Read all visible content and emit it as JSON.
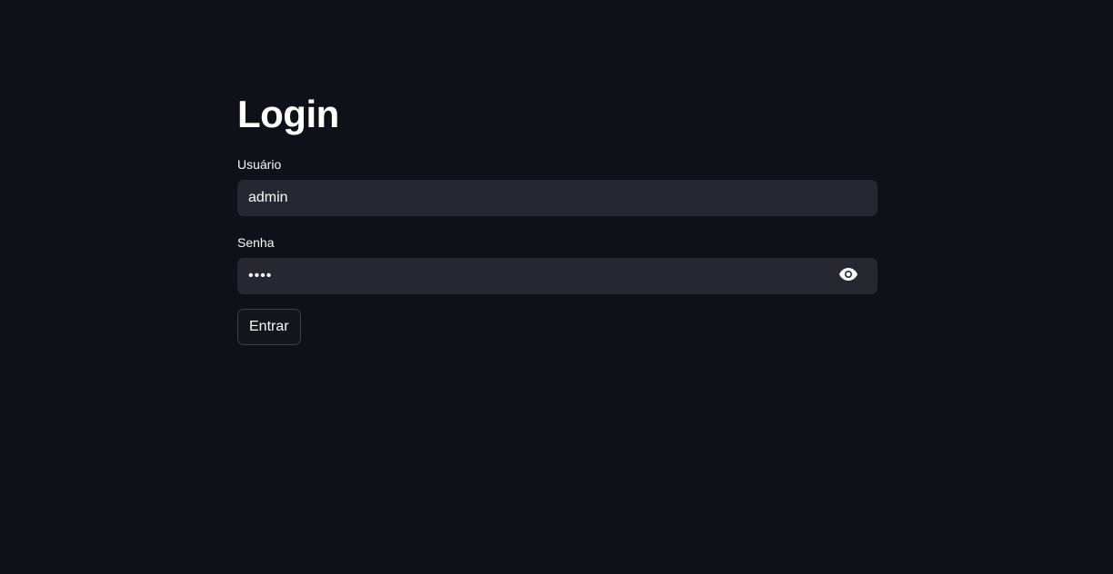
{
  "page": {
    "title": "Login",
    "background_color": "#0e1117"
  },
  "form": {
    "username": {
      "label": "Usuário",
      "value": "admin"
    },
    "password": {
      "label": "Senha",
      "value": "••••",
      "toggle_icon": "eye-icon"
    },
    "submit_label": "Entrar"
  },
  "colors": {
    "input_background": "#262730",
    "text": "#fafafa",
    "button_border": "#3c3f48"
  }
}
